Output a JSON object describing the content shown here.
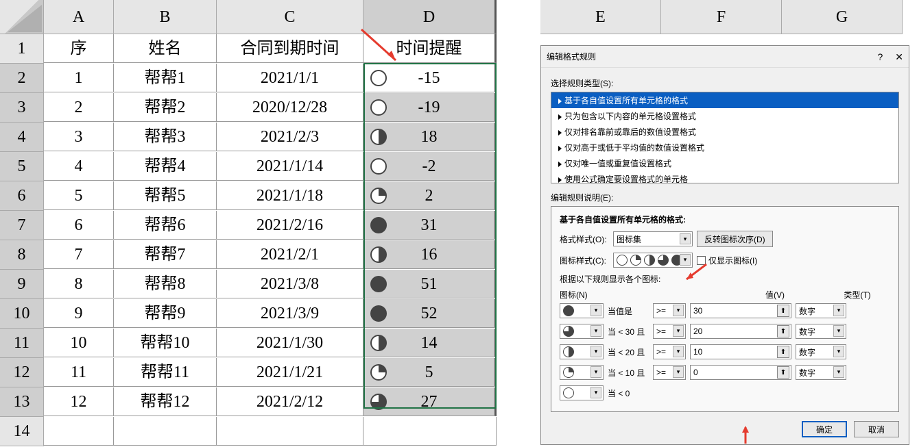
{
  "columns": [
    "A",
    "B",
    "C",
    "D"
  ],
  "extra_columns": [
    "E",
    "F",
    "G"
  ],
  "headers": {
    "A": "序",
    "B": "姓名",
    "C": "合同到期时间",
    "D": "时间提醒"
  },
  "rows": [
    {
      "n": 1,
      "A": "1",
      "B": "帮帮1",
      "C": "2021/1/1",
      "D": -15,
      "icon": "p0"
    },
    {
      "n": 2,
      "A": "2",
      "B": "帮帮2",
      "C": "2020/12/28",
      "D": -19,
      "icon": "p0"
    },
    {
      "n": 3,
      "A": "3",
      "B": "帮帮3",
      "C": "2021/2/3",
      "D": 18,
      "icon": "p50"
    },
    {
      "n": 4,
      "A": "4",
      "B": "帮帮4",
      "C": "2021/1/14",
      "D": -2,
      "icon": "p0"
    },
    {
      "n": 5,
      "A": "5",
      "B": "帮帮5",
      "C": "2021/1/18",
      "D": 2,
      "icon": "p25"
    },
    {
      "n": 6,
      "A": "6",
      "B": "帮帮6",
      "C": "2021/2/16",
      "D": 31,
      "icon": "p100"
    },
    {
      "n": 7,
      "A": "7",
      "B": "帮帮7",
      "C": "2021/2/1",
      "D": 16,
      "icon": "p50"
    },
    {
      "n": 8,
      "A": "8",
      "B": "帮帮8",
      "C": "2021/3/8",
      "D": 51,
      "icon": "p100"
    },
    {
      "n": 9,
      "A": "9",
      "B": "帮帮9",
      "C": "2021/3/9",
      "D": 52,
      "icon": "p100"
    },
    {
      "n": 10,
      "A": "10",
      "B": "帮帮10",
      "C": "2021/1/30",
      "D": 14,
      "icon": "p50"
    },
    {
      "n": 11,
      "A": "11",
      "B": "帮帮11",
      "C": "2021/1/21",
      "D": 5,
      "icon": "p25"
    },
    {
      "n": 12,
      "A": "12",
      "B": "帮帮12",
      "C": "2021/2/12",
      "D": 27,
      "icon": "p75"
    }
  ],
  "row14": "14",
  "dialog": {
    "title": "编辑格式规则",
    "select_rule_type_label": "选择规则类型(S):",
    "rule_types": [
      "基于各自值设置所有单元格的格式",
      "只为包含以下内容的单元格设置格式",
      "仅对排名靠前或靠后的数值设置格式",
      "仅对高于或低于平均值的数值设置格式",
      "仅对唯一值或重复值设置格式",
      "使用公式确定要设置格式的单元格"
    ],
    "edit_desc_label": "编辑规则说明(E):",
    "edit_title": "基于各自值设置所有单元格的格式:",
    "format_style_label": "格式样式(O):",
    "format_style_value": "图标集",
    "reverse_button": "反转图标次序(D)",
    "icon_style_label": "图标样式(C):",
    "show_icon_only": "仅显示图标(I)",
    "threshold_note": "根据以下规则显示各个图标:",
    "col_icon": "图标(N)",
    "col_value": "值(V)",
    "col_type": "类型(T)",
    "th": [
      {
        "icon": "p100",
        "when": "当值是",
        "op": ">=",
        "val": "30",
        "type": "数字"
      },
      {
        "icon": "p75",
        "when": "当 < 30 且",
        "op": ">=",
        "val": "20",
        "type": "数字"
      },
      {
        "icon": "p50",
        "when": "当 < 20 且",
        "op": ">=",
        "val": "10",
        "type": "数字"
      },
      {
        "icon": "p25",
        "when": "当 < 10 且",
        "op": ">=",
        "val": "0",
        "type": "数字"
      },
      {
        "icon": "p0",
        "when": "当 < 0",
        "op": "",
        "val": "",
        "type": ""
      }
    ],
    "ok": "确定",
    "cancel": "取消"
  }
}
